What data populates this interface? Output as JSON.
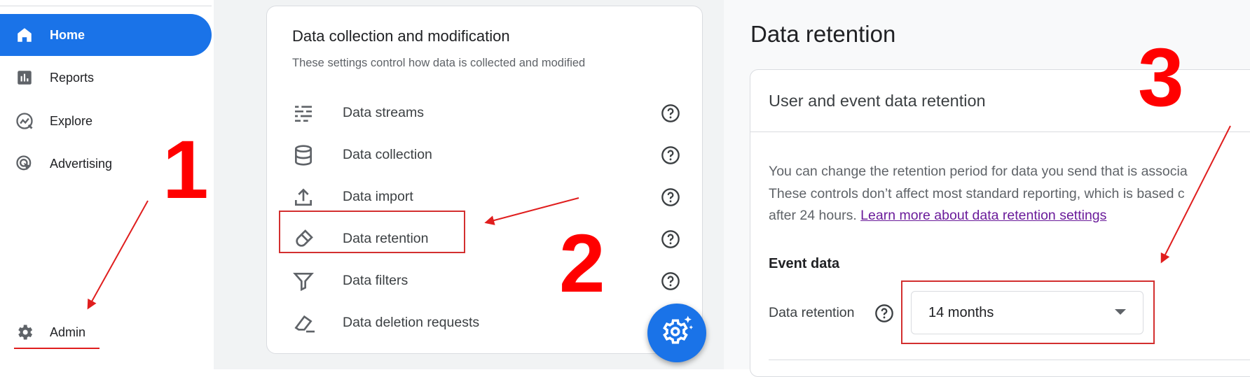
{
  "nav": {
    "items": [
      {
        "label": "Home"
      },
      {
        "label": "Reports"
      },
      {
        "label": "Explore"
      },
      {
        "label": "Advertising"
      }
    ],
    "admin_label": "Admin"
  },
  "settings_card": {
    "title": "Data collection and modification",
    "subtitle": "These settings control how data is collected and modified",
    "rows": [
      {
        "label": "Data streams"
      },
      {
        "label": "Data collection"
      },
      {
        "label": "Data import"
      },
      {
        "label": "Data retention"
      },
      {
        "label": "Data filters"
      },
      {
        "label": "Data deletion requests"
      }
    ]
  },
  "retention": {
    "page_title": "Data retention",
    "card_title": "User and event data retention",
    "para_line1": "You can change the retention period for data you send that is associa",
    "para_line2": "These controls don’t affect most standard reporting, which is based c",
    "para_line3_prefix": "after 24 hours. ",
    "learn_more_link": "Learn more about data retention settings",
    "event_heading": "Event data",
    "field_label": "Data retention",
    "field_value": "14 months"
  },
  "annotations": {
    "step1": "1",
    "step2": "2",
    "step3": "3",
    "color": "#ff0000"
  },
  "colors": {
    "primary": "#1a73e8"
  }
}
